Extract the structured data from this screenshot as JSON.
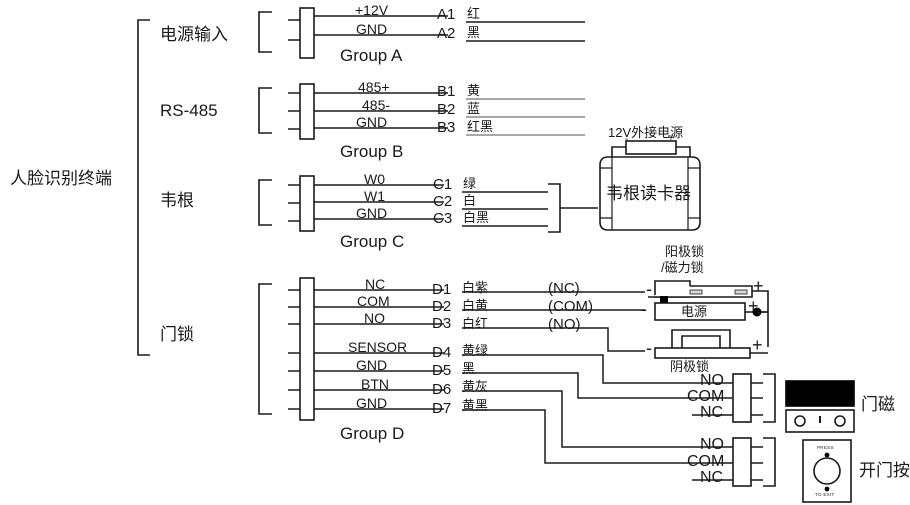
{
  "diagram": {
    "title": "人脸识别终端",
    "root_label": "人脸识别终端"
  },
  "groups": [
    {
      "id": "A",
      "name": "电源输入",
      "group_label": "Group A",
      "rows": [
        {
          "signal": "+12V",
          "pin": "A1",
          "wire": "红"
        },
        {
          "signal": "GND",
          "pin": "A2",
          "wire": "黑"
        }
      ]
    },
    {
      "id": "B",
      "name": "RS-485",
      "group_label": "Group B",
      "rows": [
        {
          "signal": "485+",
          "pin": "B1",
          "wire": "黄"
        },
        {
          "signal": "485-",
          "pin": "B2",
          "wire": "蓝"
        },
        {
          "signal": "GND",
          "pin": "B3",
          "wire": "红黑"
        }
      ]
    },
    {
      "id": "C",
      "name": "韦根",
      "group_label": "Group C",
      "rows": [
        {
          "signal": "W0",
          "pin": "C1",
          "wire": "绿"
        },
        {
          "signal": "W1",
          "pin": "C2",
          "wire": "白"
        },
        {
          "signal": "GND",
          "pin": "C3",
          "wire": "白黑"
        }
      ]
    },
    {
      "id": "D",
      "name": "门锁",
      "group_label": "Group D",
      "rows": [
        {
          "signal": "NC",
          "pin": "D1",
          "wire": "白紫",
          "contact": "(NC)"
        },
        {
          "signal": "COM",
          "pin": "D2",
          "wire": "白黄",
          "contact": "(COM)"
        },
        {
          "signal": "NO",
          "pin": "D3",
          "wire": "白红",
          "contact": "(NO)"
        },
        {
          "signal": "SENSOR",
          "pin": "D4",
          "wire": "黄绿",
          "contact": ""
        },
        {
          "signal": "GND",
          "pin": "D5",
          "wire": "黑",
          "contact": ""
        },
        {
          "signal": "BTN",
          "pin": "D6",
          "wire": "黄灰",
          "contact": ""
        },
        {
          "signal": "GND",
          "pin": "D7",
          "wire": "黄黑",
          "contact": ""
        }
      ]
    }
  ],
  "devices": {
    "wiegand_reader": {
      "label": "韦根读卡器",
      "power_label": "12V外接电源",
      "minus": "-",
      "plus": "+"
    },
    "anode_lock": {
      "line1": "阳极锁",
      "line2": "/磁力锁",
      "minus": "-",
      "plus": "+"
    },
    "power_supply": {
      "label": "电源",
      "minus": "-",
      "plus": "+"
    },
    "cathode_lock": {
      "label": "阴极锁",
      "minus": "-",
      "plus": "+"
    },
    "door_sensor": {
      "label": "门磁",
      "terminals": [
        "NO",
        "COM",
        "NC"
      ]
    },
    "exit_button": {
      "label": "开门按钮",
      "terminals": [
        "NO",
        "COM",
        "NC"
      ],
      "face_top": "PRESS",
      "face_bottom": "TO EXIT"
    }
  },
  "colors": {
    "stroke": "#1a1a1a",
    "stroke_light": "#8a8a8a",
    "background": "#ffffff",
    "sensor_black": "#000000"
  }
}
